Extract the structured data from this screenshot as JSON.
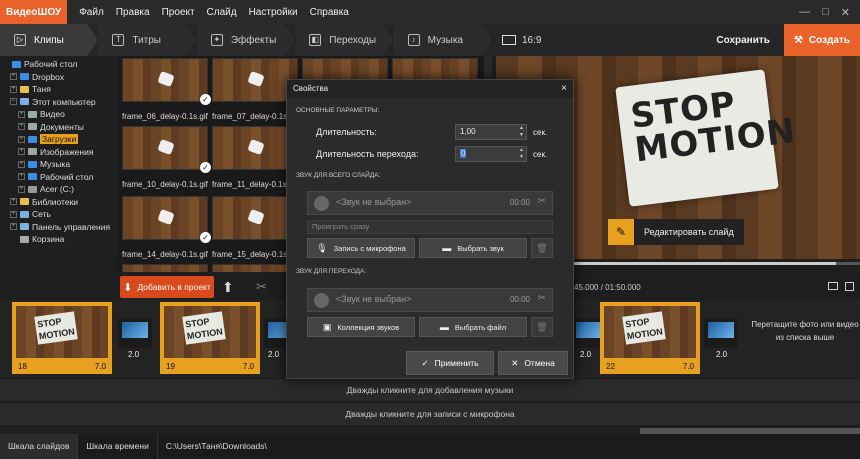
{
  "app": {
    "logo_a": "Видео",
    "logo_b": "ШОУ"
  },
  "menu": [
    "Файл",
    "Правка",
    "Проект",
    "Слайд",
    "Настройки",
    "Справка"
  ],
  "window_controls": [
    "—",
    "□",
    "✕"
  ],
  "tabs": [
    "Клипы",
    "Титры",
    "Эффекты",
    "Переходы",
    "Музыка"
  ],
  "tab_icons": [
    "clips-icon",
    "titles-icon",
    "effects-icon",
    "transitions-icon",
    "music-icon"
  ],
  "ratio": "16:9",
  "save_label": "Сохранить",
  "create_label": "Создать",
  "tree": [
    {
      "label": "Рабочий стол",
      "depth": 0,
      "exp": "",
      "color": "#3a8ee6"
    },
    {
      "label": "Dropbox",
      "depth": 1,
      "exp": "+",
      "color": "#3a8ee6"
    },
    {
      "label": "Таня",
      "depth": 1,
      "exp": "+",
      "color": "#e8c050"
    },
    {
      "label": "Этот компьютер",
      "depth": 1,
      "exp": "−",
      "color": "#7fb0e0"
    },
    {
      "label": "Видео",
      "depth": 2,
      "exp": "+",
      "color": "#9aa"
    },
    {
      "label": "Документы",
      "depth": 2,
      "exp": "+",
      "color": "#9aa"
    },
    {
      "label": "Загрузки",
      "depth": 2,
      "exp": "+",
      "color": "#3a8ee6",
      "selected": true
    },
    {
      "label": "Изображения",
      "depth": 2,
      "exp": "+",
      "color": "#9aa"
    },
    {
      "label": "Музыка",
      "depth": 2,
      "exp": "+",
      "color": "#3a8ee6"
    },
    {
      "label": "Рабочий стол",
      "depth": 2,
      "exp": "+",
      "color": "#3a8ee6"
    },
    {
      "label": "Acer (C:)",
      "depth": 2,
      "exp": "+",
      "color": "#999"
    },
    {
      "label": "Библиотеки",
      "depth": 1,
      "exp": "+",
      "color": "#e8c050"
    },
    {
      "label": "Сеть",
      "depth": 1,
      "exp": "+",
      "color": "#7fb0e0"
    },
    {
      "label": "Панель управления",
      "depth": 1,
      "exp": "+",
      "color": "#7fb0e0"
    },
    {
      "label": "Корзина",
      "depth": 1,
      "exp": "",
      "color": "#aaa"
    }
  ],
  "thumbs": [
    {
      "label": "frame_06_delay-0.1s.gif"
    },
    {
      "label": "frame_07_delay-0.1s.gif"
    },
    {
      "label": "frame_10_delay-0.1s.gif"
    },
    {
      "label": "frame_11_delay-0.1s.gif"
    },
    {
      "label": "frame_14_delay-0.1s.gif"
    },
    {
      "label": "frame_15_delay-0.1s.gif"
    }
  ],
  "add_to_project": "Добавить в проект",
  "preview": {
    "stop_text": "STOP MOTION",
    "edit_label": "Редактировать слайд",
    "time": "45.000 / 01:50.000",
    "progress": 0.934
  },
  "timeline": {
    "slides": [
      {
        "num": "18",
        "dur": "7.0",
        "text": "STOP MOTION"
      },
      {
        "num": "19",
        "dur": "7.0",
        "text": "STOP MOTION"
      },
      {
        "num": "22",
        "dur": "7.0",
        "text": "STOP MOTION"
      }
    ],
    "transitions": [
      "2.0",
      "2.0",
      "2.0",
      "2.0"
    ],
    "drop_hint": "Перетащите фото или видео из списка выше",
    "music_hint": "Дважды кликните для добавления музыки",
    "mic_hint": "Дважды кликните для записи с микрофона"
  },
  "status": {
    "slides_tab": "Шкала слайдов",
    "time_tab": "Шкала времени",
    "path": "C:\\Users\\Таня\\Downloads\\"
  },
  "dialog": {
    "title": "Свойства",
    "close": "×",
    "main_params": "ОСНОВНЫЕ ПАРАМЕТРЫ:",
    "duration_label": "Длительность:",
    "duration_value": "1,00",
    "trans_duration_label": "Длительность перехода:",
    "trans_duration_value": "0",
    "unit": "сек.",
    "slide_sound": "ЗВУК ДЛЯ ВСЕГО СЛАЙДА:",
    "no_sound": "<Звук не выбран>",
    "time": "00:00",
    "play_mode": "Проиграть сразу",
    "mic_record": "Запись с микрофона",
    "choose_sound": "Выбрать звук",
    "trans_sound": "ЗВУК ДЛЯ ПЕРЕХОДА:",
    "sound_collection": "Коллекция звуков",
    "choose_file": "Выбрать файл",
    "apply": "Применить",
    "cancel": "Отмена"
  }
}
